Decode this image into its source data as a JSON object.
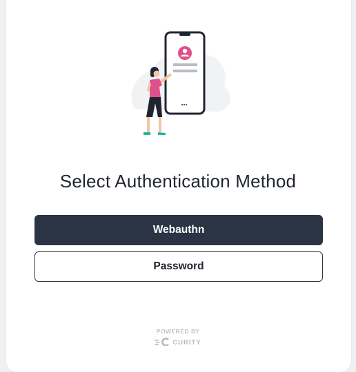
{
  "page": {
    "title": "Select Authentication Method"
  },
  "methods": [
    {
      "label": "Webauthn",
      "style": "primary"
    },
    {
      "label": "Password",
      "style": "secondary"
    }
  ],
  "footer": {
    "powered_by": "POWERED BY",
    "brand": "CURITY",
    "brand_icon": "curity-logo-icon"
  },
  "illustration": {
    "icon": "phone-login-illustration",
    "colors": {
      "accent": "#e0518b",
      "dark": "#1f2530",
      "teal": "#2bb0a0"
    }
  },
  "colors": {
    "primary_button": "#2a3445",
    "background": "#eef0f3",
    "card": "#ffffff"
  }
}
